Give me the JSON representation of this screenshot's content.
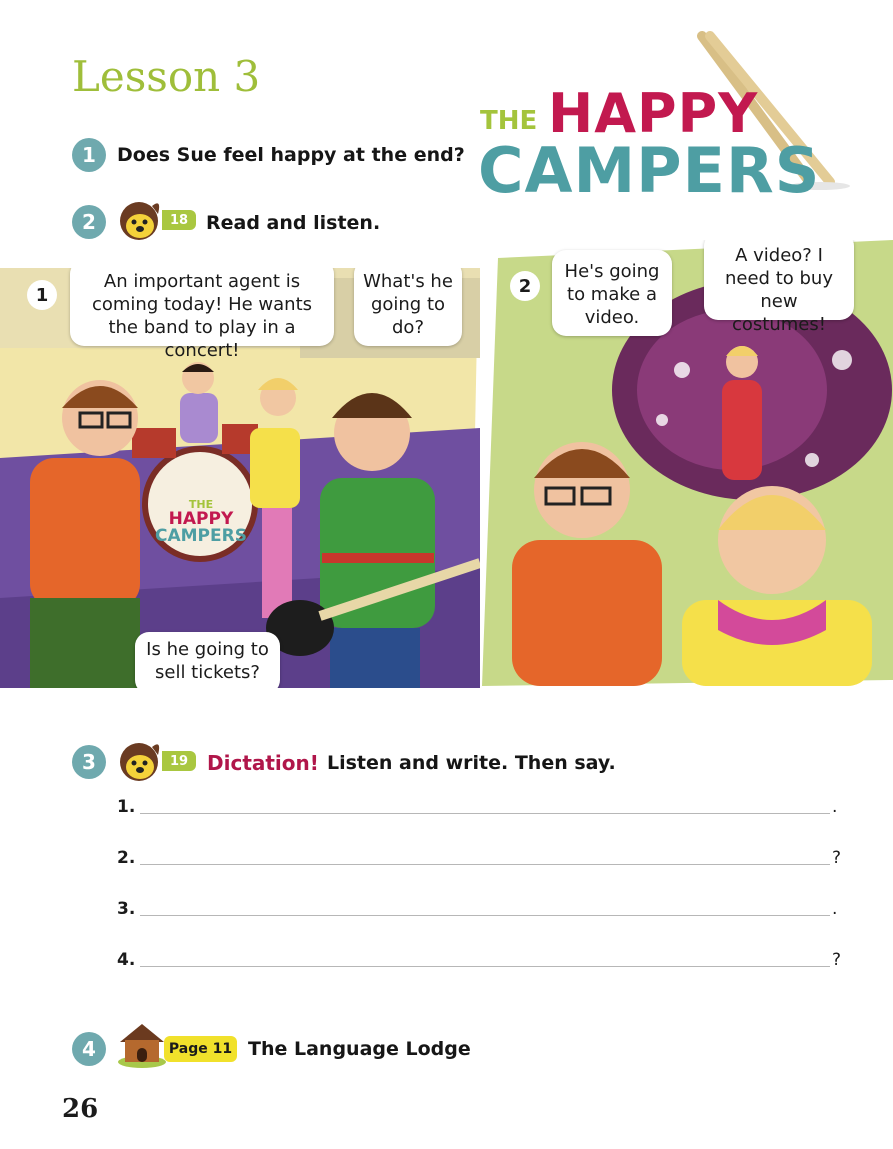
{
  "lesson_title": "Lesson 3",
  "logo": {
    "the": "THE",
    "happy": "HAPPY",
    "campers": "CAMPERS"
  },
  "items": [
    {
      "number": "1",
      "text": "Does Sue feel happy at the end?"
    },
    {
      "number": "2",
      "track": "18",
      "text": "Read and listen."
    },
    {
      "number": "3",
      "track": "19",
      "highlight": "Dictation!",
      "text": "Listen and write. Then say."
    },
    {
      "number": "4",
      "badge": "Page 11",
      "text": "The Language Lodge"
    }
  ],
  "comic": {
    "panel1": {
      "number": "1",
      "bubbles": [
        "An important agent is coming today! He wants the band to play in a concert!",
        "What's he going to do?",
        "Is he going to sell tickets?"
      ],
      "drum_logo": {
        "the": "THE",
        "happy": "HAPPY",
        "campers": "CAMPERS"
      }
    },
    "panel2": {
      "number": "2",
      "bubbles": [
        "He's going to make a video.",
        "A video? I need to buy new costumes!"
      ]
    }
  },
  "dictation_lines": [
    {
      "label": "1.",
      "end": "."
    },
    {
      "label": "2.",
      "end": "?"
    },
    {
      "label": "3.",
      "end": "."
    },
    {
      "label": "4.",
      "end": "?"
    }
  ],
  "page_number": "26",
  "colors": {
    "title_green": "#9fbe3a",
    "number_teal": "#6fa9ae",
    "dictation_red": "#b0164a",
    "badge_yellow": "#f1e12b"
  }
}
